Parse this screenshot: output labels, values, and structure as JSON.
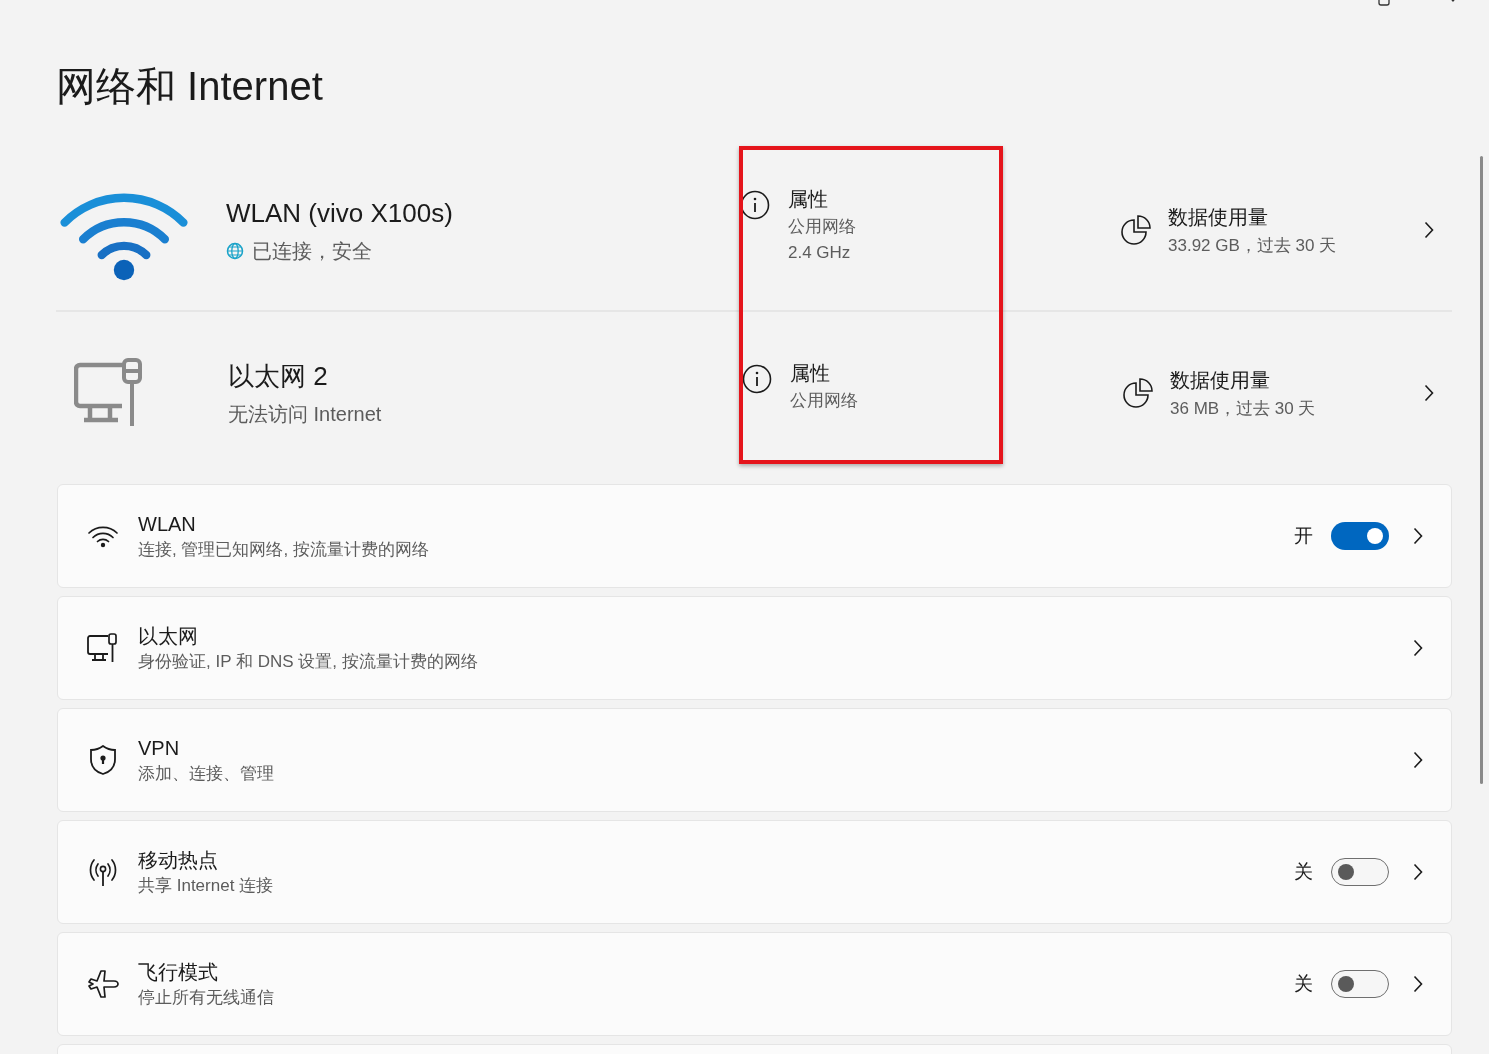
{
  "title": "网络和 Internet",
  "connections": [
    {
      "kind": "wifi",
      "name": "WLAN (vivo X100s)",
      "status": "已连接，安全",
      "secured": true,
      "properties": {
        "label": "属性",
        "lines": [
          "公用网络",
          "2.4 GHz"
        ]
      },
      "usage": {
        "label": "数据使用量",
        "detail": "33.92 GB，过去 30 天"
      }
    },
    {
      "kind": "ethernet",
      "name": "以太网 2",
      "status": "无法访问 Internet",
      "secured": false,
      "properties": {
        "label": "属性",
        "lines": [
          "公用网络"
        ]
      },
      "usage": {
        "label": "数据使用量",
        "detail": "36 MB，过去 30 天"
      }
    }
  ],
  "settings": [
    {
      "kind": "wifi",
      "title": "WLAN",
      "subtitle": "连接, 管理已知网络, 按流量计费的网络",
      "toggle": {
        "label": "开",
        "on": true
      }
    },
    {
      "kind": "ethernet",
      "title": "以太网",
      "subtitle": "身份验证, IP 和 DNS 设置, 按流量计费的网络"
    },
    {
      "kind": "vpn",
      "title": "VPN",
      "subtitle": "添加、连接、管理"
    },
    {
      "kind": "hotspot",
      "title": "移动热点",
      "subtitle": "共享 Internet 连接",
      "toggle": {
        "label": "关",
        "on": false
      }
    },
    {
      "kind": "airplane",
      "title": "飞行模式",
      "subtitle": "停止所有无线通信",
      "toggle": {
        "label": "关",
        "on": false
      }
    }
  ]
}
